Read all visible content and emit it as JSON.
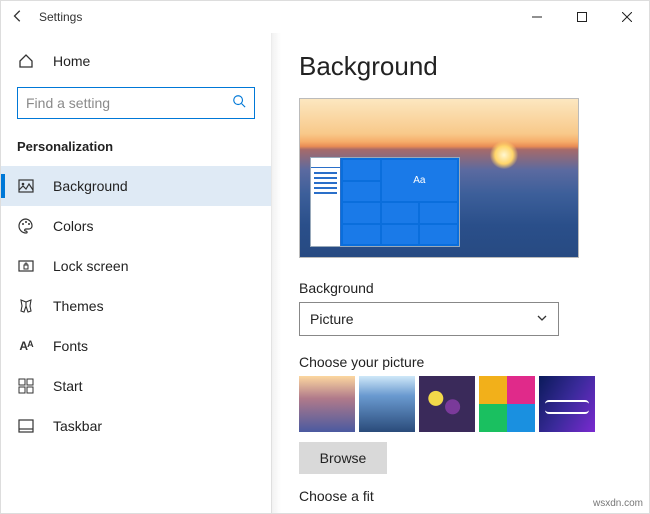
{
  "titlebar": {
    "app_name": "Settings"
  },
  "sidebar": {
    "home_label": "Home",
    "search_placeholder": "Find a setting",
    "section_header": "Personalization",
    "items": [
      {
        "label": "Background"
      },
      {
        "label": "Colors"
      },
      {
        "label": "Lock screen"
      },
      {
        "label": "Themes"
      },
      {
        "label": "Fonts"
      },
      {
        "label": "Start"
      },
      {
        "label": "Taskbar"
      }
    ]
  },
  "content": {
    "page_title": "Background",
    "preview_tile_text": "Aa",
    "bg_field_label": "Background",
    "bg_dropdown_value": "Picture",
    "choose_picture_label": "Choose your picture",
    "browse_label": "Browse",
    "choose_fit_label": "Choose a fit"
  },
  "watermark": "wsxdn.com"
}
